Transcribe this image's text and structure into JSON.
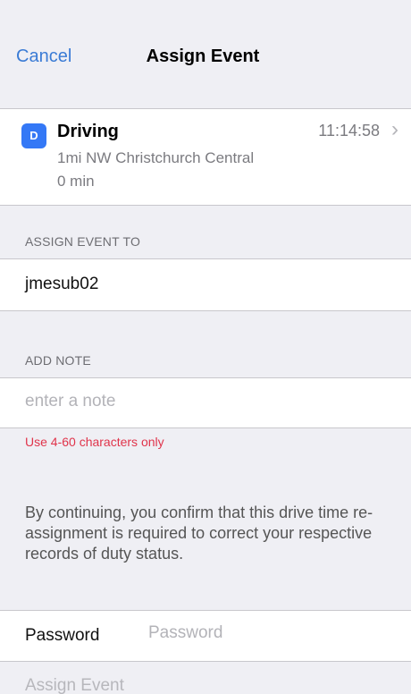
{
  "nav": {
    "cancel_label": "Cancel",
    "title": "Assign Event"
  },
  "event": {
    "badge": "D",
    "title": "Driving",
    "location": "1mi NW Christchurch Central",
    "duration": "0 min",
    "time": "11:14:58",
    "chevron": "›"
  },
  "assign": {
    "header": "ASSIGN EVENT TO",
    "driver": "jmesub02"
  },
  "note": {
    "header": "ADD NOTE",
    "placeholder": "enter a note",
    "value": "",
    "error": "Use 4-60 characters only"
  },
  "disclaimer": "By continuing, you confirm that this drive time re-assignment is required to correct your respective records of duty status.",
  "password": {
    "label": "Password",
    "placeholder": "Password"
  },
  "submit_label": "Assign Event",
  "colors": {
    "accent": "#3a7bd5",
    "badge": "#3478f6",
    "error": "#e0344b",
    "background": "#efeff4"
  }
}
